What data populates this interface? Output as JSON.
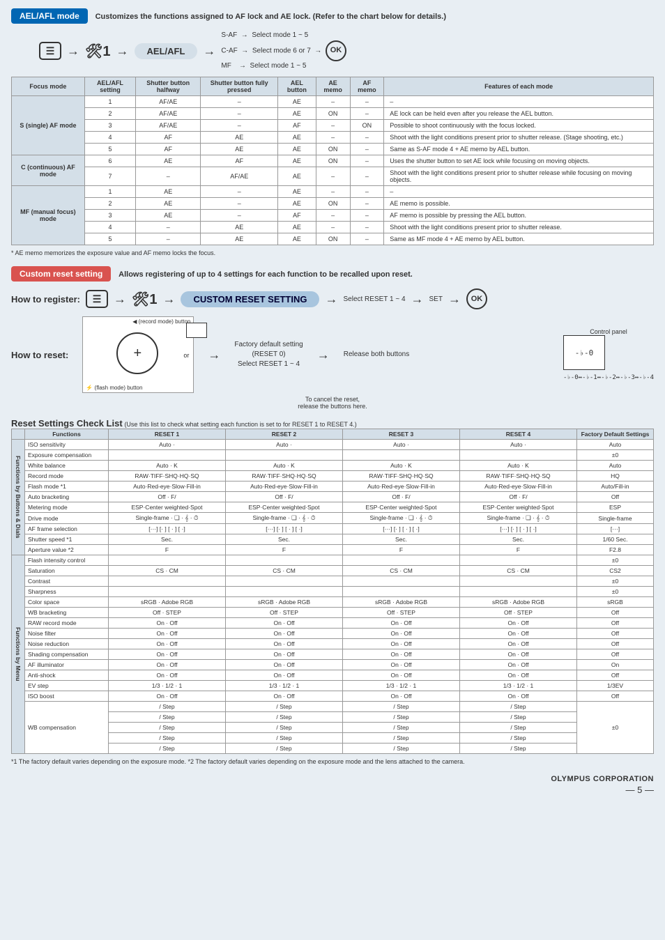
{
  "ael": {
    "tag": "AEL/AFL mode",
    "desc": "Customizes the functions assigned to AF lock and AE lock. (Refer to the chart below for details.)",
    "pill": "AEL/AFL",
    "modes": {
      "saf": "S-AF",
      "caf": "C-AF",
      "mf": "MF",
      "saf_note": "Select mode 1 ~ 5",
      "caf_note": "Select mode 6 or 7",
      "mf_note": "Select mode 1 ~ 5"
    },
    "headers": {
      "focus": "Focus mode",
      "setting": "AEL/AFL setting",
      "shutter_half": "Shutter button halfway",
      "shutter_full": "Shutter button fully pressed",
      "ael_btn": "AEL button",
      "ae_memo": "AE memo",
      "af_memo": "AF memo",
      "features": "Features of each mode"
    },
    "groups": [
      {
        "name": "S (single) AF mode",
        "rows": [
          {
            "n": "1",
            "half": "AF/AE",
            "full": "–",
            "ael": "AE",
            "aem": "–",
            "afm": "–",
            "feat": "–"
          },
          {
            "n": "2",
            "half": "AF/AE",
            "full": "–",
            "ael": "AE",
            "aem": "ON",
            "afm": "–",
            "feat": "AE lock can be held even after you release the AEL button."
          },
          {
            "n": "3",
            "half": "AF/AE",
            "full": "–",
            "ael": "AF",
            "aem": "–",
            "afm": "ON",
            "feat": "Possible to shoot continuously with the focus locked."
          },
          {
            "n": "4",
            "half": "AF",
            "full": "AE",
            "ael": "AE",
            "aem": "–",
            "afm": "–",
            "feat": "Shoot with the light conditions present prior to shutter release. (Stage shooting, etc.)"
          },
          {
            "n": "5",
            "half": "AF",
            "full": "AE",
            "ael": "AE",
            "aem": "ON",
            "afm": "–",
            "feat": "Same as S-AF mode 4 + AE memo by AEL button."
          }
        ]
      },
      {
        "name": "C (continuous) AF mode",
        "rows": [
          {
            "n": "6",
            "half": "AE",
            "full": "AF",
            "ael": "AE",
            "aem": "ON",
            "afm": "–",
            "feat": "Uses the shutter button to set AE lock while focusing on moving objects."
          },
          {
            "n": "7",
            "half": "–",
            "full": "AF/AE",
            "ael": "AE",
            "aem": "–",
            "afm": "–",
            "feat": "Shoot with the light conditions present prior to shutter release while focusing on moving objects."
          }
        ]
      },
      {
        "name": "MF (manual focus) mode",
        "rows": [
          {
            "n": "1",
            "half": "AE",
            "full": "–",
            "ael": "AE",
            "aem": "–",
            "afm": "–",
            "feat": "–"
          },
          {
            "n": "2",
            "half": "AE",
            "full": "–",
            "ael": "AE",
            "aem": "ON",
            "afm": "–",
            "feat": "AE memo is possible."
          },
          {
            "n": "3",
            "half": "AE",
            "full": "–",
            "ael": "AF",
            "aem": "–",
            "afm": "–",
            "feat": "AF memo is possible by pressing the AEL button."
          },
          {
            "n": "4",
            "half": "–",
            "full": "AE",
            "ael": "AE",
            "aem": "–",
            "afm": "–",
            "feat": "Shoot with the light conditions present prior to shutter release."
          },
          {
            "n": "5",
            "half": "–",
            "full": "AE",
            "ael": "AE",
            "aem": "ON",
            "afm": "–",
            "feat": "Same as MF mode 4 + AE memo by AEL button."
          }
        ]
      }
    ],
    "footnote": "* AE memo memorizes the exposure value and AF memo locks the focus."
  },
  "custom": {
    "tag": "Custom reset setting",
    "desc": "Allows registering of up to 4 settings for each function to be recalled upon reset.",
    "howreg": "How to register:",
    "pill": "CUSTOM RESET SETTING",
    "select_reset": "Select RESET 1 ~ 4",
    "set": "SET",
    "howreset": "How to reset:",
    "record_btn": "(record mode) button",
    "flash_btn": "(flash mode) button",
    "or": "or",
    "factory": "Factory default setting\n(RESET 0)\nSelect RESET 1 ~ 4",
    "release": "Release both buttons",
    "cancel": "To cancel the reset,\nrelease the buttons here.",
    "panel_label": "Control panel",
    "panel_text": "-♭-0"
  },
  "reset": {
    "title": "Reset Settings Check List",
    "sub": "(Use this list to check what setting each function is set to for RESET 1 to RESET 4.)",
    "headers": {
      "func": "Functions",
      "r1": "RESET 1",
      "r2": "RESET 2",
      "r3": "RESET 3",
      "r4": "RESET 4",
      "def": "Factory Default Settings"
    },
    "sidebar1": "Functions by Buttons & Dials",
    "sidebar2": "Functions by Menu",
    "rows1": [
      {
        "func": "ISO sensitivity",
        "r": "Auto ·",
        "def": "Auto"
      },
      {
        "func": "Exposure compensation",
        "r": "",
        "def": "±0"
      },
      {
        "func": "White balance",
        "r": "Auto · K",
        "def": "Auto"
      },
      {
        "func": "Record mode",
        "r": "RAW·TIFF·SHQ·HQ·SQ",
        "def": "HQ"
      },
      {
        "func": "Flash mode *1",
        "r": "Auto·Red-eye·Slow·Fill-in",
        "def": "Auto/Fill-in"
      },
      {
        "func": "Auto bracketing",
        "r": "Off · F/",
        "def": "Off"
      },
      {
        "func": "Metering mode",
        "r": "ESP·Center weighted·Spot",
        "def": "ESP"
      },
      {
        "func": "Drive mode",
        "r": "Single-frame · ❏ · 𝄞 · ⏱",
        "def": "Single-frame"
      },
      {
        "func": "AF frame selection",
        "r": "[···] [·  ] [ · ] [  ·]",
        "def": "[···]"
      },
      {
        "func": "Shutter speed *1",
        "r": "Sec.",
        "def": "1/60 Sec."
      },
      {
        "func": "Aperture value *2",
        "r": "F",
        "def": "F2.8"
      }
    ],
    "rows2": [
      {
        "func": "Flash intensity control",
        "r": "",
        "def": "±0"
      },
      {
        "func": "Saturation",
        "r": "CS · CM",
        "def": "CS2"
      },
      {
        "func": "Contrast",
        "r": "",
        "def": "±0"
      },
      {
        "func": "Sharpness",
        "r": "",
        "def": "±0"
      },
      {
        "func": "Color space",
        "r": "sRGB · Adobe RGB",
        "def": "sRGB"
      },
      {
        "func": "WB bracketing",
        "r": "Off · STEP",
        "def": "Off"
      },
      {
        "func": "RAW record mode",
        "r": "On · Off",
        "def": "Off"
      },
      {
        "func": "Noise filter",
        "r": "On · Off",
        "def": "Off"
      },
      {
        "func": "Noise reduction",
        "r": "On · Off",
        "def": "Off"
      },
      {
        "func": "Shading compensation",
        "r": "On · Off",
        "def": "Off"
      },
      {
        "func": "AF illuminator",
        "r": "On · Off",
        "def": "On"
      },
      {
        "func": "Anti-shock",
        "r": "On · Off",
        "def": "Off"
      },
      {
        "func": "EV step",
        "r": "1/3 · 1/2 · 1",
        "def": "1/3EV"
      },
      {
        "func": "ISO boost",
        "r": "On · Off",
        "def": "Off"
      }
    ],
    "wb": {
      "func": "WB compensation",
      "cell": "/ Step",
      "def": "±0"
    },
    "footnote": "*1 The factory default varies depending on the exposure mode. *2 The factory default varies depending on the exposure mode and the lens attached to the camera."
  },
  "corp": "OLYMPUS CORPORATION",
  "pagenum": "— 5 —"
}
